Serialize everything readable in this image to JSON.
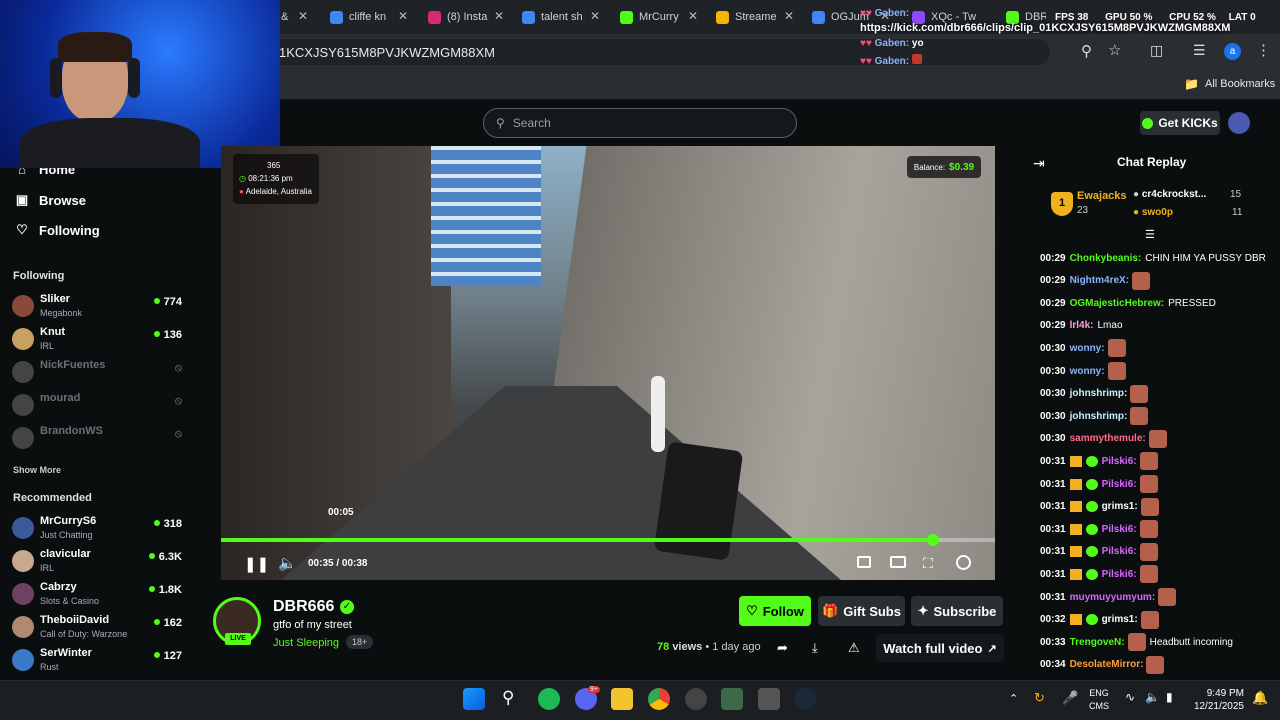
{
  "tabs": [
    {
      "label": "&",
      "color": "#444"
    },
    {
      "label": "cliffe kn",
      "color": "#4285f4"
    },
    {
      "label": "(8) Insta",
      "color": "#d62976"
    },
    {
      "label": "talent sh",
      "color": "#4285f4"
    },
    {
      "label": "MrCurry",
      "color": "#53fc18"
    },
    {
      "label": "Streame",
      "color": "#f4b400"
    },
    {
      "label": "OGJum",
      "color": "#4285f4"
    },
    {
      "label": "XQc - Tw",
      "color": "#9146ff"
    },
    {
      "label": "DBR",
      "color": "#53fc18"
    }
  ],
  "address": {
    "url": "1KCXJSY615M8PVJKWZMGM88XM"
  },
  "bookmarks": {
    "all_label": "All Bookmarks"
  },
  "overlay": {
    "fps_label": "FPS",
    "fps": "38",
    "gpu_label": "GPU",
    "gpu": "50 %",
    "cpu_label": "CPU",
    "cpu": "52 %",
    "lat_label": "LAT",
    "lat": "0",
    "clip_url": "https://kick.com/dbr666/clips/clip_01KCXJSY615M8PVJKWZMGM88XM",
    "chat": [
      {
        "user": "Gaben:",
        "text": ""
      },
      {
        "user": "Gaben:",
        "text": "yo"
      },
      {
        "user": "Gaben:",
        "text": ""
      }
    ]
  },
  "topbar": {
    "search_placeholder": "Search",
    "get_kicks": "Get KICKs"
  },
  "sidebar": {
    "nav": [
      {
        "label": "Home",
        "icon": "home-icon"
      },
      {
        "label": "Browse",
        "icon": "browse-icon"
      },
      {
        "label": "Following",
        "icon": "heart-icon"
      }
    ],
    "following_heading": "Following",
    "following": [
      {
        "name": "Sliker",
        "category": "Megabonk",
        "viewers": "774",
        "live": true,
        "color": "#8a4a3a"
      },
      {
        "name": "Knut",
        "category": "IRL",
        "viewers": "136",
        "live": true,
        "color": "#c8a060"
      },
      {
        "name": "NickFuentes",
        "category": "",
        "viewers": "",
        "live": false,
        "color": "#888"
      },
      {
        "name": "mourad",
        "category": "",
        "viewers": "",
        "live": false,
        "color": "#888"
      },
      {
        "name": "BrandonWS",
        "category": "",
        "viewers": "",
        "live": false,
        "color": "#888"
      }
    ],
    "show_more": "Show More",
    "recommended_heading": "Recommended",
    "recommended": [
      {
        "name": "MrCurryS6",
        "category": "Just Chatting",
        "viewers": "318",
        "color": "#3a5a9a"
      },
      {
        "name": "clavicular",
        "category": "IRL",
        "viewers": "6.3K",
        "color": "#c9a890"
      },
      {
        "name": "Cabrzy",
        "category": "Slots & Casino",
        "viewers": "1.8K",
        "color": "#704060"
      },
      {
        "name": "TheboiiDavid",
        "category": "Call of Duty: Warzone",
        "viewers": "162",
        "color": "#b08a70"
      },
      {
        "name": "SerWinter",
        "category": "Rust",
        "viewers": "127",
        "color": "#3a7ac8"
      }
    ]
  },
  "video": {
    "balance_label": "Balance:",
    "balance": "$0.39",
    "overlay_num": "365",
    "overlay_time": "08:21:36 pm",
    "overlay_location": "Adelaide, Australia",
    "hover_time": "00:05",
    "current_time": "00:35",
    "separator": "/",
    "duration": "00:38",
    "progress": 0.92
  },
  "streamer": {
    "name": "DBR666",
    "title": "gtfo of my street",
    "category": "Just Sleeping",
    "age_tag": "18+",
    "live_badge": "LIVE",
    "views_count": "78",
    "views_label": "views",
    "dot": "•",
    "posted": "1 day ago",
    "follow": "Follow",
    "gift_subs": "Gift Subs",
    "subscribe": "Subscribe",
    "watch_full": "Watch full video"
  },
  "chat": {
    "title": "Chat Replay",
    "top_gifters": [
      {
        "rank": "1",
        "name": "Ewajacks",
        "count": "23"
      },
      {
        "name": "cr4ckrockst...",
        "count": "15"
      },
      {
        "name": "swo0p",
        "count": "11"
      }
    ],
    "messages": [
      {
        "time": "00:29",
        "user": "Chonkybeanis:",
        "text": "CHIN HIM YA PUSSY DBR",
        "color": "#53fc18",
        "emote": false,
        "badges": false
      },
      {
        "time": "00:29",
        "user": "Nightm4reX:",
        "text": "",
        "color": "#8ab4f8",
        "emote": true,
        "badges": false
      },
      {
        "time": "00:29",
        "user": "OGMajesticHebrew:",
        "text": "PRESSED",
        "color": "#53fc18",
        "emote": false,
        "badges": false
      },
      {
        "time": "00:29",
        "user": "lrl4k:",
        "text": "Lmao",
        "color": "#ff9de2",
        "emote": false,
        "badges": false
      },
      {
        "time": "00:30",
        "user": "wonny:",
        "text": "",
        "color": "#8ab4f8",
        "emote": true,
        "badges": false
      },
      {
        "time": "00:30",
        "user": "wonny:",
        "text": "",
        "color": "#8ab4f8",
        "emote": true,
        "badges": false
      },
      {
        "time": "00:30",
        "user": "johnshrimp:",
        "text": "",
        "color": "#c8f0ff",
        "emote": true,
        "badges": false
      },
      {
        "time": "00:30",
        "user": "johnshrimp:",
        "text": "",
        "color": "#c8f0ff",
        "emote": true,
        "badges": false
      },
      {
        "time": "00:30",
        "user": "sammythemule:",
        "text": "",
        "color": "#ff6b8a",
        "emote": true,
        "badges": false
      },
      {
        "time": "00:31",
        "user": "Pilski6:",
        "text": "",
        "color": "#d966ff",
        "emote": true,
        "badges": true
      },
      {
        "time": "00:31",
        "user": "Pilski6:",
        "text": "",
        "color": "#d966ff",
        "emote": true,
        "badges": true
      },
      {
        "time": "00:31",
        "user": "grims1:",
        "text": "",
        "color": "#fff",
        "emote": true,
        "badges": true
      },
      {
        "time": "00:31",
        "user": "Pilski6:",
        "text": "",
        "color": "#d966ff",
        "emote": true,
        "badges": true
      },
      {
        "time": "00:31",
        "user": "Pilski6:",
        "text": "",
        "color": "#d966ff",
        "emote": true,
        "badges": true
      },
      {
        "time": "00:31",
        "user": "Pilski6:",
        "text": "",
        "color": "#d966ff",
        "emote": true,
        "badges": true
      },
      {
        "time": "00:31",
        "user": "muymuyyumyum:",
        "text": "",
        "color": "#d966ff",
        "emote": true,
        "badges": false
      },
      {
        "time": "00:32",
        "user": "grims1:",
        "text": "",
        "color": "#fff",
        "emote": true,
        "badges": true
      },
      {
        "time": "00:33",
        "user": "TrengoveN:",
        "text": "Headbutt incoming",
        "color": "#53fc18",
        "emote": true,
        "badges": false
      },
      {
        "time": "00:34",
        "user": "DesolateMirror:",
        "text": "",
        "color": "#ff9d3a",
        "emote": true,
        "badges": false
      }
    ]
  },
  "taskbar": {
    "lang1": "ENG",
    "lang2": "CMS",
    "time": "9:49 PM",
    "date": "12/21/2025",
    "discord_badge": "9+"
  }
}
